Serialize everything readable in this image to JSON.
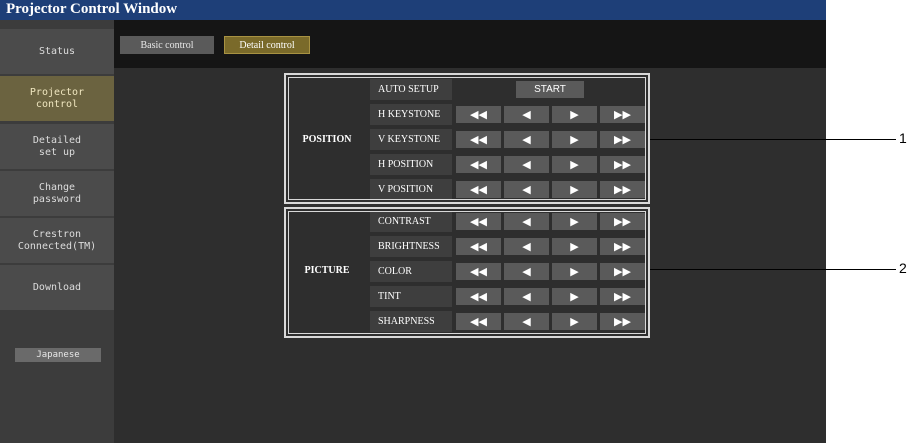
{
  "window": {
    "title": "Projector Control Window"
  },
  "sidebar": {
    "items": [
      {
        "label": "Status"
      },
      {
        "label": "Projector\ncontrol",
        "active": true
      },
      {
        "label": "Detailed\nset up"
      },
      {
        "label": "Change\npassword"
      },
      {
        "label": "Crestron\nConnected(TM)"
      },
      {
        "label": "Download"
      }
    ],
    "language_button": "Japanese"
  },
  "tabs": [
    {
      "label": "Basic control"
    },
    {
      "label": "Detail control",
      "active": true
    }
  ],
  "position_group": {
    "label": "POSITION",
    "auto_setup": {
      "label": "AUTO SETUP",
      "button": "START"
    },
    "rows": [
      {
        "label": "H KEYSTONE"
      },
      {
        "label": "V KEYSTONE"
      },
      {
        "label": "H POSITION"
      },
      {
        "label": "V POSITION"
      }
    ]
  },
  "picture_group": {
    "label": "PICTURE",
    "rows": [
      {
        "label": "CONTRAST"
      },
      {
        "label": "BRIGHTNESS"
      },
      {
        "label": "COLOR"
      },
      {
        "label": "TINT"
      },
      {
        "label": "SHARPNESS"
      }
    ]
  },
  "controls": {
    "fast_decrease": "◀◀",
    "decrease": "◀",
    "increase": "▶",
    "fast_increase": "▶▶"
  },
  "callouts": [
    "1",
    "2"
  ],
  "colors": {
    "title_bar": "#1e3f78",
    "active_tab": "#7a6a2a",
    "active_side": "#6b6340",
    "background": "#2e2e2e"
  }
}
